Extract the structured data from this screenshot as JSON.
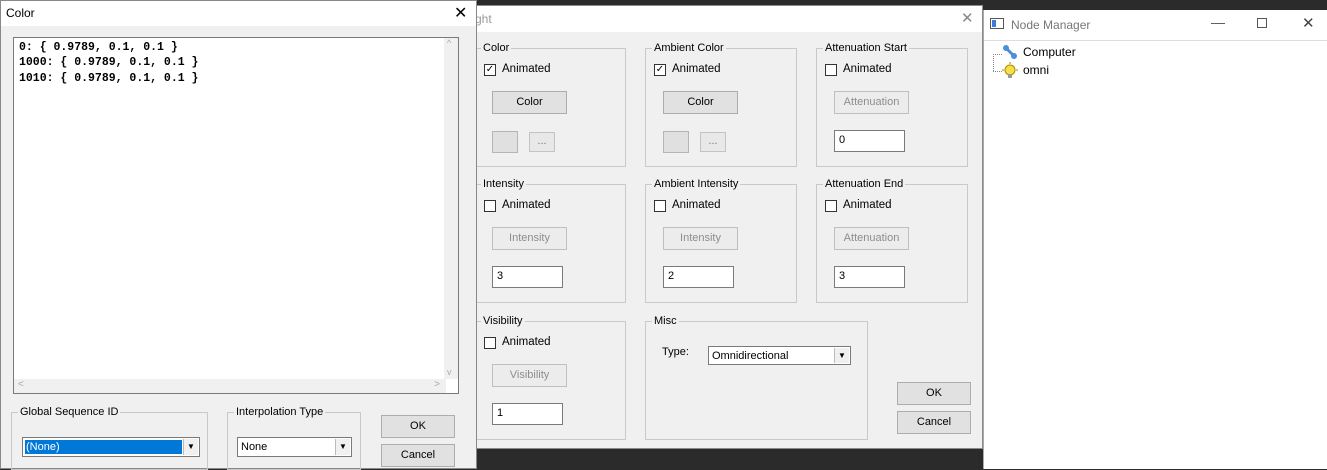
{
  "light_window": {
    "title": "ght",
    "groups": {
      "color": {
        "label": "Color",
        "animated_label": "Animated",
        "animated": true,
        "button": "Color",
        "dots": "..."
      },
      "ambient_color": {
        "label": "Ambient Color",
        "animated_label": "Animated",
        "animated": true,
        "button": "Color",
        "dots": "..."
      },
      "attenuation_start": {
        "label": "Attenuation Start",
        "animated_label": "Animated",
        "animated": false,
        "button": "Attenuation",
        "value": "0"
      },
      "intensity": {
        "label": "Intensity",
        "animated_label": "Animated",
        "animated": false,
        "button": "Intensity",
        "value": "3"
      },
      "ambient_intensity": {
        "label": "Ambient Intensity",
        "animated_label": "Animated",
        "animated": false,
        "button": "Intensity",
        "value": "2"
      },
      "attenuation_end": {
        "label": "Attenuation End",
        "animated_label": "Animated",
        "animated": false,
        "button": "Attenuation",
        "value": "3"
      },
      "visibility": {
        "label": "Visibility",
        "animated_label": "Animated",
        "animated": false,
        "button": "Visibility",
        "value": "1"
      },
      "misc": {
        "label": "Misc",
        "type_label": "Type:",
        "type_value": "Omnidirectional"
      }
    },
    "ok": "OK",
    "cancel": "Cancel"
  },
  "node_manager": {
    "title": "Node Manager",
    "nodes": [
      {
        "label": "Computer",
        "icon": "bone-icon"
      },
      {
        "label": "omni",
        "icon": "light-bulb-icon"
      }
    ]
  },
  "color_window": {
    "title": "Color",
    "keys": [
      "0: { 0.9789, 0.1, 0.1 }",
      "1000: { 0.9789, 0.1, 0.1 }",
      "1010: { 0.9789, 0.1, 0.1 }"
    ],
    "global_sequence": {
      "label": "Global Sequence ID",
      "value": "(None)"
    },
    "interpolation": {
      "label": "Interpolation Type",
      "value": "None"
    },
    "ok": "OK",
    "cancel": "Cancel"
  },
  "colors": {
    "selection": "#0078d7",
    "checkmark": "#000000"
  }
}
